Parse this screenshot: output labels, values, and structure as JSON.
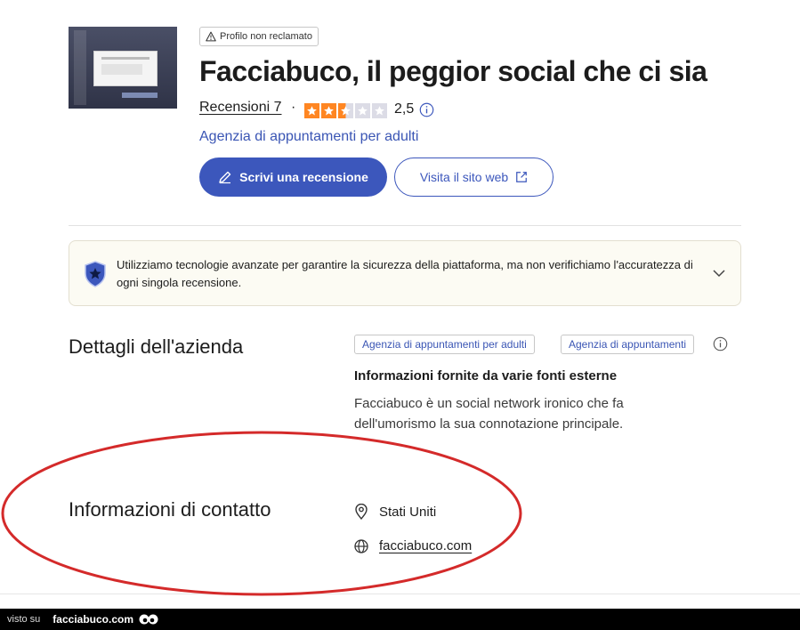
{
  "header": {
    "unclaimed_badge": "Profilo non reclamato",
    "title": "Facciabuco, il peggior social che ci sia",
    "reviews_link": "Recensioni 7",
    "separator": "·",
    "rating": 2.5,
    "rating_text": "2,5",
    "category_link": "Agenzia di appuntamenti per adulti",
    "write_review_label": "Scrivi una recensione",
    "visit_site_label": "Visita il sito web"
  },
  "notice": {
    "text": "Utilizziamo tecnologie avanzate per garantire la sicurezza della piattaforma, ma non verifichiamo l'accuratezza di ogni singola recensione."
  },
  "details": {
    "heading": "Dettagli dell'azienda",
    "tags": [
      "Agenzia di appuntamenti per adulti",
      "Agenzia di appuntamenti"
    ],
    "source_title": "Informazioni fornite da varie fonti esterne",
    "description": "Facciabuco è un social network ironico che fa dell'umorismo la sua connotazione principale."
  },
  "contact": {
    "heading": "Informazioni di contatto",
    "location": "Stati Uniti",
    "website": "facciabuco.com"
  },
  "footer": {
    "visto_su": "visto su",
    "brand": "facciabuco.com"
  },
  "colors": {
    "accent": "#3c57bc",
    "star_filled": "#ff8622",
    "star_empty": "#dcdce6",
    "annotation": "#d42a2a"
  }
}
